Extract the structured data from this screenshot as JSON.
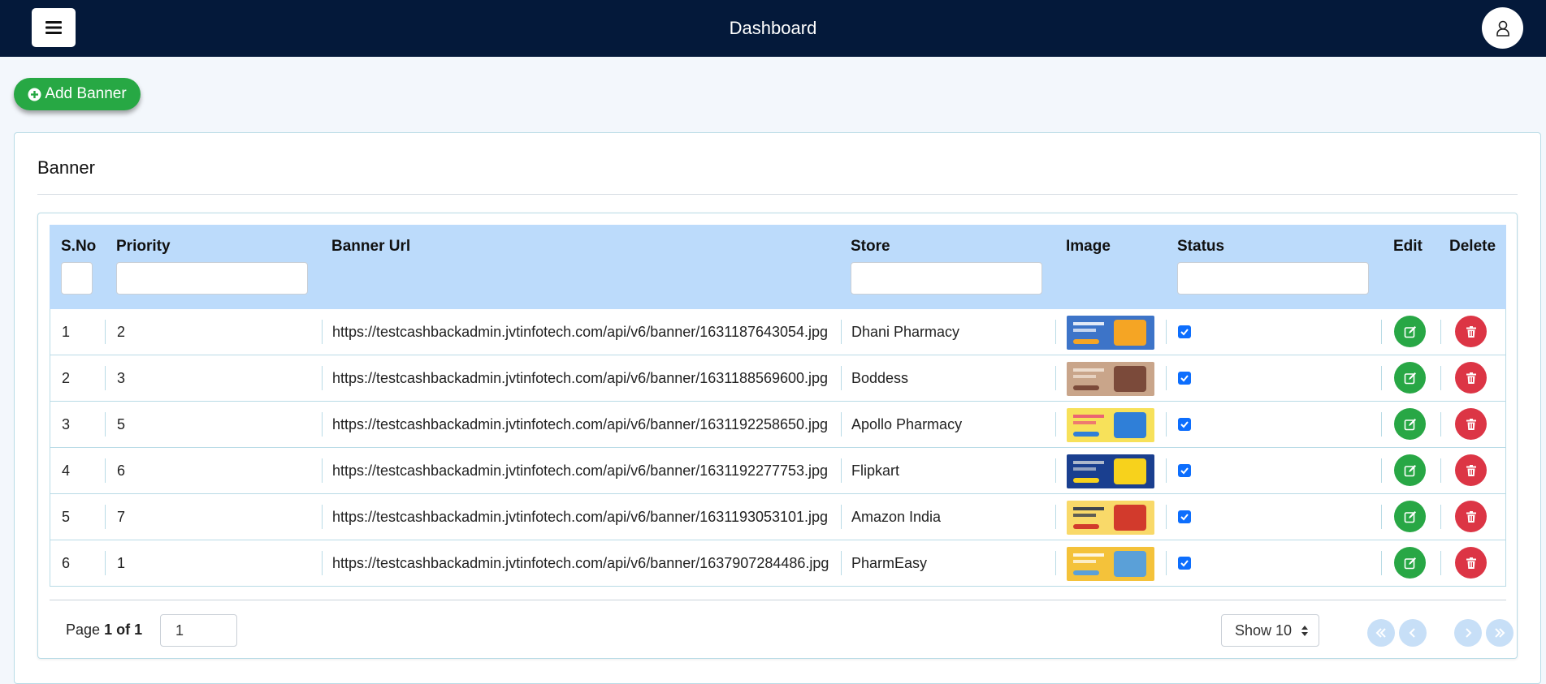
{
  "header": {
    "title": "Dashboard",
    "menu_icon": "hamburger-menu-icon",
    "user_icon": "user-icon",
    "background": "#04193a"
  },
  "toolbar": {
    "add_banner_label": "Add Banner",
    "add_icon": "plus-circle-icon",
    "accent": "#27a844"
  },
  "card": {
    "title": "Banner"
  },
  "table": {
    "columns": [
      "S.No",
      "Priority",
      "Banner Url",
      "Store",
      "Image",
      "Status",
      "Edit",
      "Delete"
    ],
    "rows": [
      {
        "sno": "1",
        "priority": "2",
        "url": "https://testcashbackadmin.jvtinfotech.com/api/v6/banner/1631187643054.jpg",
        "store": "Dhani Pharmacy",
        "status": true,
        "thumb_colors": [
          "#3d74c8",
          "#f5a524",
          "#ffffff"
        ]
      },
      {
        "sno": "2",
        "priority": "3",
        "url": "https://testcashbackadmin.jvtinfotech.com/api/v6/banner/1631188569600.jpg",
        "store": "Boddess",
        "status": true,
        "thumb_colors": [
          "#c9a58a",
          "#7b4a3a",
          "#f3e5d8"
        ]
      },
      {
        "sno": "3",
        "priority": "5",
        "url": "https://testcashbackadmin.jvtinfotech.com/api/v6/banner/1631192258650.jpg",
        "store": "Apollo Pharmacy",
        "status": true,
        "thumb_colors": [
          "#f7e15a",
          "#2f7fd8",
          "#e94e77"
        ]
      },
      {
        "sno": "4",
        "priority": "6",
        "url": "https://testcashbackadmin.jvtinfotech.com/api/v6/banner/1631192277753.jpg",
        "store": "Flipkart",
        "status": true,
        "thumb_colors": [
          "#1a3f8f",
          "#f7d21c",
          "#c8ced6"
        ]
      },
      {
        "sno": "5",
        "priority": "7",
        "url": "https://testcashbackadmin.jvtinfotech.com/api/v6/banner/1631193053101.jpg",
        "store": "Amazon India",
        "status": true,
        "thumb_colors": [
          "#f9d969",
          "#d23a2c",
          "#1e2a4a"
        ]
      },
      {
        "sno": "6",
        "priority": "1",
        "url": "https://testcashbackadmin.jvtinfotech.com/api/v6/banner/1637907284486.jpg",
        "store": "PharmEasy",
        "status": true,
        "thumb_colors": [
          "#f4c23a",
          "#5aa0d8",
          "#ffffff"
        ]
      }
    ]
  },
  "pagination": {
    "page_prefix": "Page",
    "page_status": "1 of 1",
    "page_input_value": "1",
    "show_label": "Show 10",
    "first_icon": "double-chevron-left-icon",
    "prev_icon": "chevron-left-icon",
    "next_icon": "chevron-right-icon",
    "last_icon": "double-chevron-right-icon"
  },
  "colors": {
    "table_header": "#bcdbfb",
    "edit": "#28a745",
    "delete": "#dc3545",
    "checkbox": "#0d6efd"
  }
}
